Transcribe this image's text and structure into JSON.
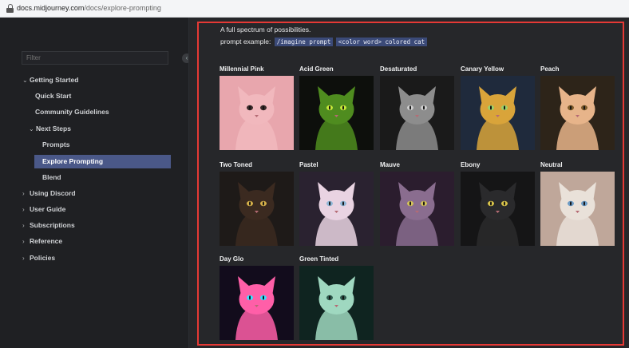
{
  "browser": {
    "url_host": "docs.midjourney.com",
    "url_path": "/docs/explore-prompting"
  },
  "sidebar": {
    "filter_placeholder": "Filter",
    "items": [
      {
        "label": "Getting Started",
        "chevron": "⌄"
      },
      {
        "label": "Quick Start"
      },
      {
        "label": "Community Guidelines"
      },
      {
        "label": "Next Steps",
        "chevron": "⌄"
      },
      {
        "label": "Prompts"
      },
      {
        "label": "Explore Prompting",
        "active": true
      },
      {
        "label": "Blend"
      },
      {
        "label": "Using Discord",
        "chevron": "›"
      },
      {
        "label": "User Guide",
        "chevron": "›"
      },
      {
        "label": "Subscriptions",
        "chevron": "›"
      },
      {
        "label": "Reference",
        "chevron": "›"
      },
      {
        "label": "Policies",
        "chevron": "›"
      }
    ]
  },
  "main": {
    "subtitle": "A full spectrum of possibilities.",
    "prompt_label": "prompt example:",
    "prompt_code_1": "/imagine prompt",
    "prompt_code_2": "<color word> colored cat",
    "cards": [
      {
        "label": "Millennial Pink",
        "bg": "#e8a6ad",
        "cat": "#f1b8bd",
        "eye": "#3a2a2a"
      },
      {
        "label": "Acid Green",
        "bg": "#0d0f0c",
        "cat": "#4f8c1f",
        "eye": "#c7e83a"
      },
      {
        "label": "Desaturated",
        "bg": "#1a1a1a",
        "cat": "#8d8d8d",
        "eye": "#cfcfcf"
      },
      {
        "label": "Canary Yellow",
        "bg": "#1f2a3c",
        "cat": "#d9a43a",
        "eye": "#9bd16a"
      },
      {
        "label": "Peach",
        "bg": "#2d2419",
        "cat": "#e7b48a",
        "eye": "#7b5a2a"
      },
      {
        "label": "Two Toned",
        "bg": "#1e1a18",
        "cat": "#3b2a20",
        "eye": "#d6b04a"
      },
      {
        "label": "Pastel",
        "bg": "#2a2230",
        "cat": "#e9d3e2",
        "eye": "#8fb6d6"
      },
      {
        "label": "Mauve",
        "bg": "#2b1d2e",
        "cat": "#8a6d8f",
        "eye": "#d3c25a"
      },
      {
        "label": "Ebony",
        "bg": "#151516",
        "cat": "#2a2a2c",
        "eye": "#d8c34a"
      },
      {
        "label": "Neutral",
        "bg": "#bfa79a",
        "cat": "#e9e1d9",
        "eye": "#6d9bc4"
      },
      {
        "label": "Day Glo",
        "bg": "#120c1c",
        "cat": "#ff5fa8",
        "eye": "#39e0ff"
      },
      {
        "label": "Green Tinted",
        "bg": "#0f2420",
        "cat": "#9fd8c0",
        "eye": "#2f5a4e"
      }
    ]
  }
}
